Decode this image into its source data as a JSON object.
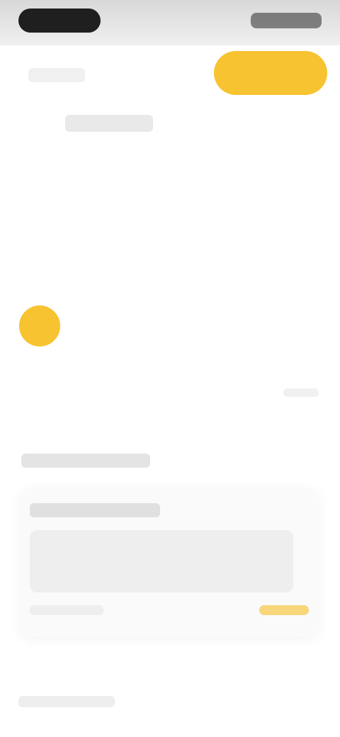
{
  "header": {
    "back_label": "",
    "action_label": ""
  },
  "calendar": {
    "month_title": "",
    "weekdays": [
      "",
      "",
      "",
      "",
      "",
      "",
      ""
    ],
    "weeks": [
      [
        "",
        "",
        "",
        "",
        "",
        "",
        ""
      ],
      [
        "",
        "",
        "",
        "",
        "",
        "",
        ""
      ],
      [
        "",
        "",
        "",
        "",
        "",
        "",
        ""
      ],
      [
        "",
        "",
        "",
        "",
        "",
        "",
        ""
      ],
      [
        "",
        "",
        ""
      ]
    ],
    "footer_text": "",
    "accent_color": "#f7c331"
  },
  "events": {
    "section_title": "",
    "card": {
      "title": "",
      "description": "",
      "meta": "",
      "action": ""
    }
  },
  "footer": {
    "link_label": ""
  }
}
